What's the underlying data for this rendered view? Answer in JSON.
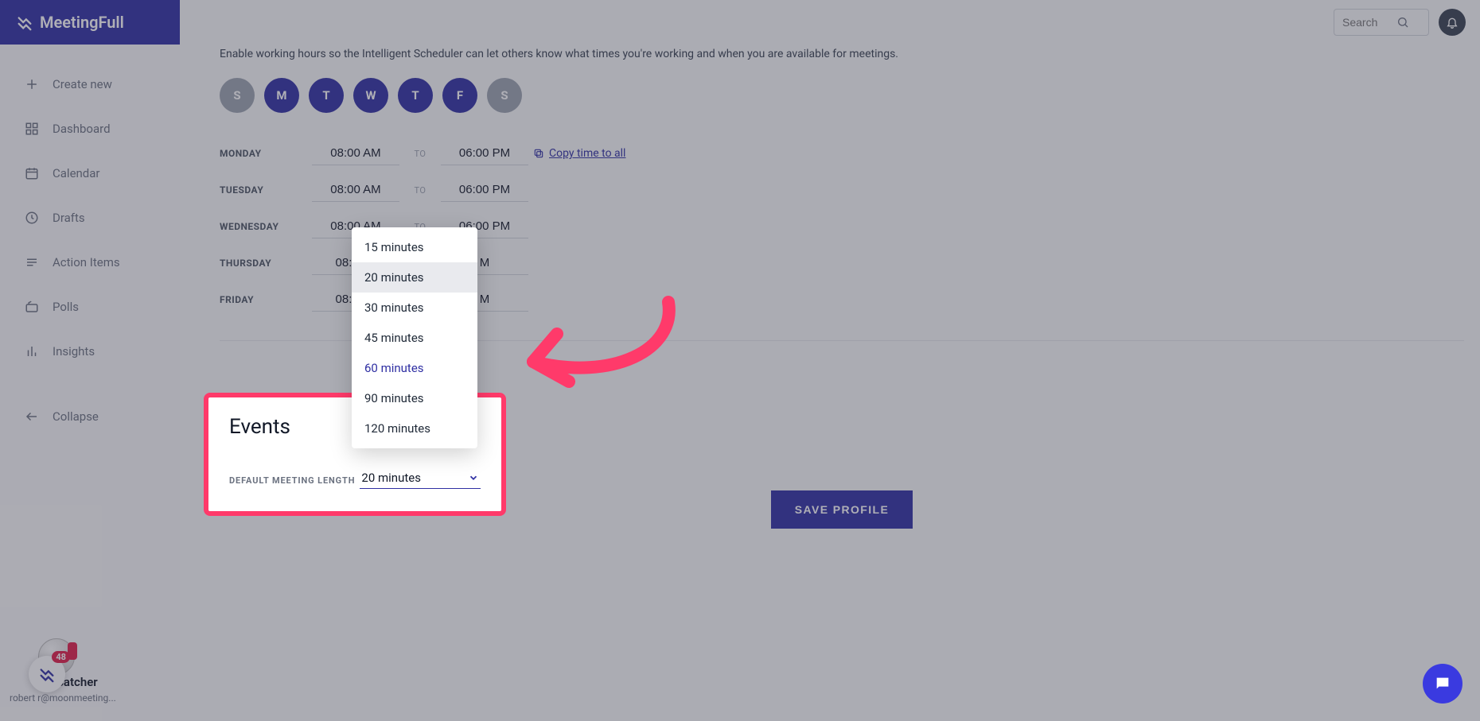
{
  "brand": {
    "name": "MeetingFull"
  },
  "topbar": {
    "search_placeholder": "Search"
  },
  "sidebar": {
    "create_label": "Create new",
    "items": [
      {
        "label": "Dashboard"
      },
      {
        "label": "Calendar"
      },
      {
        "label": "Drafts"
      },
      {
        "label": "Action Items"
      },
      {
        "label": "Polls"
      },
      {
        "label": "Insights"
      }
    ],
    "collapse_label": "Collapse"
  },
  "user": {
    "name_fragment": "t Satcher",
    "email_fragment": "robert          r@moonmeeting...",
    "intercom_badge": "48"
  },
  "working_hours": {
    "description": "Enable working hours so the Intelligent Scheduler can let others know what times you're working and when you are available for meetings.",
    "days_header": [
      {
        "letter": "S",
        "active": false
      },
      {
        "letter": "M",
        "active": true
      },
      {
        "letter": "T",
        "active": true
      },
      {
        "letter": "W",
        "active": true
      },
      {
        "letter": "T",
        "active": true
      },
      {
        "letter": "F",
        "active": true
      },
      {
        "letter": "S",
        "active": false
      }
    ],
    "to_label": "TO",
    "copy_link": "Copy time to all",
    "rows": [
      {
        "day": "MONDAY",
        "start": "08:00 AM",
        "end": "06:00 PM"
      },
      {
        "day": "TUESDAY",
        "start": "08:00 AM",
        "end": "06:00 PM"
      },
      {
        "day": "WEDNESDAY",
        "start": "08:00 AM",
        "end": "06:00 PM"
      },
      {
        "day": "THURSDAY",
        "start": "08:00 A",
        "end": "M"
      },
      {
        "day": "FRIDAY",
        "start": "08:00 A",
        "end": "M"
      }
    ]
  },
  "events": {
    "title": "Events",
    "field_label": "DEFAULT MEETING LENGTH",
    "selected": "20 minutes"
  },
  "meeting_length_options": [
    "15 minutes",
    "20 minutes",
    "30 minutes",
    "45 minutes",
    "60 minutes",
    "90 minutes",
    "120 minutes"
  ],
  "save_button_label": "SAVE PROFILE"
}
